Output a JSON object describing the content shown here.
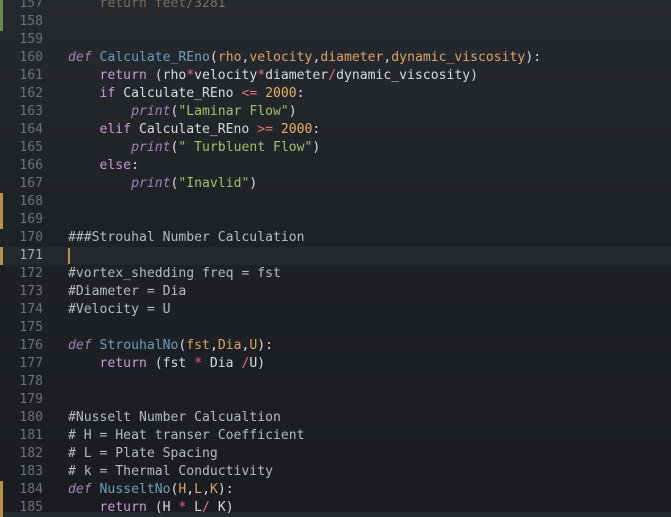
{
  "editor": {
    "lines": [
      {
        "n": "157",
        "tokens": [
          {
            "t": "    return feet/3281",
            "c": "dim"
          }
        ]
      },
      {
        "n": "158",
        "tokens": []
      },
      {
        "n": "159",
        "tokens": []
      },
      {
        "n": "160",
        "tokens": [
          {
            "t": "def",
            "c": "kw"
          },
          {
            "t": " ",
            "c": "txt"
          },
          {
            "t": "Calculate_REno",
            "c": "fn"
          },
          {
            "t": "(",
            "c": "txt"
          },
          {
            "t": "rho",
            "c": "param"
          },
          {
            "t": ",",
            "c": "txt"
          },
          {
            "t": "velocity",
            "c": "param"
          },
          {
            "t": ",",
            "c": "txt"
          },
          {
            "t": "diameter",
            "c": "param"
          },
          {
            "t": ",",
            "c": "txt"
          },
          {
            "t": "dynamic_viscosity",
            "c": "param"
          },
          {
            "t": "):",
            "c": "txt"
          }
        ]
      },
      {
        "n": "161",
        "tokens": [
          {
            "t": "    return ",
            "c": "kw2"
          },
          {
            "t": "(rho",
            "c": "txt"
          },
          {
            "t": "*",
            "c": "op"
          },
          {
            "t": "velocity",
            "c": "txt"
          },
          {
            "t": "*",
            "c": "op"
          },
          {
            "t": "diameter",
            "c": "txt"
          },
          {
            "t": "/",
            "c": "op"
          },
          {
            "t": "dynamic_viscosity)",
            "c": "txt"
          }
        ]
      },
      {
        "n": "162",
        "tokens": [
          {
            "t": "    if ",
            "c": "kw2"
          },
          {
            "t": "Calculate_REno ",
            "c": "txt"
          },
          {
            "t": "<=",
            "c": "op"
          },
          {
            "t": " ",
            "c": "txt"
          },
          {
            "t": "2000",
            "c": "num"
          },
          {
            "t": ":",
            "c": "txt"
          }
        ]
      },
      {
        "n": "163",
        "tokens": [
          {
            "t": "        ",
            "c": "txt"
          },
          {
            "t": "print",
            "c": "bi"
          },
          {
            "t": "(",
            "c": "txt"
          },
          {
            "t": "\"Laminar Flow\"",
            "c": "str"
          },
          {
            "t": ")",
            "c": "txt"
          }
        ]
      },
      {
        "n": "164",
        "tokens": [
          {
            "t": "    elif ",
            "c": "kw2"
          },
          {
            "t": "Calculate_REno ",
            "c": "txt"
          },
          {
            "t": ">=",
            "c": "op"
          },
          {
            "t": " ",
            "c": "txt"
          },
          {
            "t": "2000",
            "c": "num"
          },
          {
            "t": ":",
            "c": "txt"
          }
        ]
      },
      {
        "n": "165",
        "tokens": [
          {
            "t": "        ",
            "c": "txt"
          },
          {
            "t": "print",
            "c": "bi"
          },
          {
            "t": "(",
            "c": "txt"
          },
          {
            "t": "\" Turbluent Flow\"",
            "c": "str"
          },
          {
            "t": ")",
            "c": "txt"
          }
        ]
      },
      {
        "n": "166",
        "tokens": [
          {
            "t": "    else",
            "c": "kw2"
          },
          {
            "t": ":",
            "c": "txt"
          }
        ]
      },
      {
        "n": "167",
        "tokens": [
          {
            "t": "        ",
            "c": "txt"
          },
          {
            "t": "print",
            "c": "bi"
          },
          {
            "t": "(",
            "c": "txt"
          },
          {
            "t": "\"Inavlid\"",
            "c": "str"
          },
          {
            "t": ")",
            "c": "txt"
          }
        ]
      },
      {
        "n": "168",
        "tokens": []
      },
      {
        "n": "169",
        "tokens": []
      },
      {
        "n": "170",
        "tokens": [
          {
            "t": "###Strouhal Number Calculation",
            "c": "cm"
          }
        ]
      },
      {
        "n": "171",
        "tokens": [],
        "current": true
      },
      {
        "n": "172",
        "tokens": [
          {
            "t": "#vortex_shedding freq = fst",
            "c": "cm"
          }
        ]
      },
      {
        "n": "173",
        "tokens": [
          {
            "t": "#Diameter = Dia",
            "c": "cm"
          }
        ]
      },
      {
        "n": "174",
        "tokens": [
          {
            "t": "#Velocity = U",
            "c": "cm"
          }
        ]
      },
      {
        "n": "175",
        "tokens": []
      },
      {
        "n": "176",
        "tokens": [
          {
            "t": "def",
            "c": "kw"
          },
          {
            "t": " ",
            "c": "txt"
          },
          {
            "t": "StrouhalNo",
            "c": "fn"
          },
          {
            "t": "(",
            "c": "txt"
          },
          {
            "t": "fst",
            "c": "param"
          },
          {
            "t": ",",
            "c": "txt"
          },
          {
            "t": "Dia",
            "c": "param"
          },
          {
            "t": ",",
            "c": "txt"
          },
          {
            "t": "U",
            "c": "param"
          },
          {
            "t": "):",
            "c": "txt"
          }
        ]
      },
      {
        "n": "177",
        "tokens": [
          {
            "t": "    return ",
            "c": "kw2"
          },
          {
            "t": "(fst ",
            "c": "txt"
          },
          {
            "t": "*",
            "c": "op"
          },
          {
            "t": " Dia ",
            "c": "txt"
          },
          {
            "t": "/",
            "c": "op"
          },
          {
            "t": "U)",
            "c": "txt"
          }
        ]
      },
      {
        "n": "178",
        "tokens": []
      },
      {
        "n": "179",
        "tokens": []
      },
      {
        "n": "180",
        "tokens": [
          {
            "t": "#Nusselt Number Calcualtion",
            "c": "cm"
          }
        ]
      },
      {
        "n": "181",
        "tokens": [
          {
            "t": "# H = Heat transer Coefficient",
            "c": "cm"
          }
        ]
      },
      {
        "n": "182",
        "tokens": [
          {
            "t": "# L = Plate Spacing",
            "c": "cm"
          }
        ]
      },
      {
        "n": "183",
        "tokens": [
          {
            "t": "# k = Thermal Conductivity",
            "c": "cm"
          }
        ]
      },
      {
        "n": "184",
        "tokens": [
          {
            "t": "def",
            "c": "kw"
          },
          {
            "t": " ",
            "c": "txt"
          },
          {
            "t": "NusseltNo",
            "c": "fn"
          },
          {
            "t": "(",
            "c": "txt"
          },
          {
            "t": "H",
            "c": "param"
          },
          {
            "t": ",",
            "c": "txt"
          },
          {
            "t": "L",
            "c": "param"
          },
          {
            "t": ",",
            "c": "txt"
          },
          {
            "t": "K",
            "c": "param"
          },
          {
            "t": "):",
            "c": "txt"
          }
        ]
      },
      {
        "n": "185",
        "tokens": [
          {
            "t": "    return ",
            "c": "kw2"
          },
          {
            "t": "(H ",
            "c": "txt"
          },
          {
            "t": "*",
            "c": "op"
          },
          {
            "t": " L",
            "c": "txt"
          },
          {
            "t": "/",
            "c": "op"
          },
          {
            "t": " K)",
            "c": "txt"
          }
        ]
      }
    ],
    "gutter_marks": [
      {
        "from": "157",
        "to": "158",
        "color": "green"
      },
      {
        "from": "168",
        "to": "169",
        "color": "gold"
      },
      {
        "from": "171",
        "to": "171",
        "color": "gold"
      },
      {
        "from": "184",
        "to": "185",
        "color": "gold"
      }
    ],
    "colors": {
      "background": "#1f2226",
      "keyword": "#a483b7",
      "function": "#68a0c0",
      "parameter": "#dba36b",
      "operator": "#e1707a",
      "number": "#e3b563",
      "string": "#9fc16d",
      "comment": "#b6bbc1",
      "modified_marker": "#b99048"
    }
  }
}
